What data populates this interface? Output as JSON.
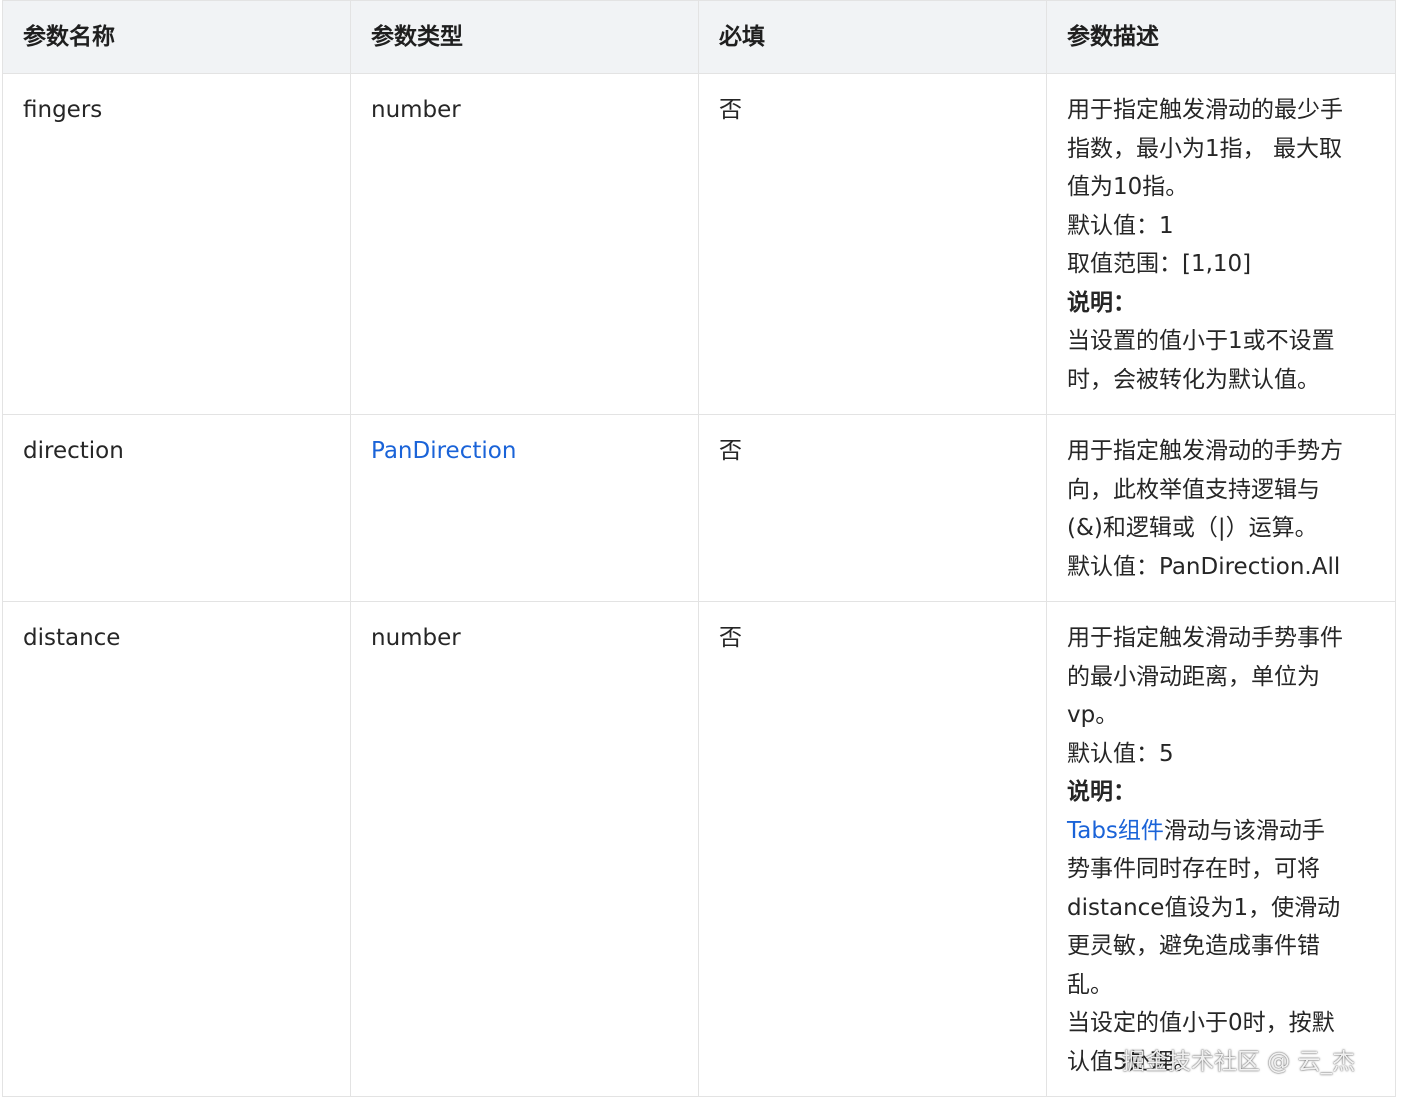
{
  "table": {
    "headers": [
      "参数名称",
      "参数类型",
      "必填",
      "参数描述"
    ],
    "rows": [
      {
        "name": "fingers",
        "type": "number",
        "type_is_link": false,
        "required": "否",
        "description_lines": [
          "用于指定触发滑动的最少手",
          "指数，最小为1指， 最大取",
          "值为10指。",
          "默认值：1",
          "取值范围：[1,10]"
        ],
        "note_title": "说明：",
        "note_lines": [
          "当设置的值小于1或不设置",
          "时，会被转化为默认值。"
        ]
      },
      {
        "name": "direction",
        "type": "PanDirection",
        "type_is_link": true,
        "required": "否",
        "description_lines": [
          "用于指定触发滑动的手势方",
          "向，此枚举值支持逻辑与",
          "(&)和逻辑或（|）运算。",
          "默认值：PanDirection.All"
        ]
      },
      {
        "name": "distance",
        "type": "number",
        "type_is_link": false,
        "required": "否",
        "description_lines": [
          "用于指定触发滑动手势事件",
          "的最小滑动距离，单位为",
          "vp。",
          "默认值：5"
        ],
        "note_title": "说明：",
        "note_link": "Tabs组件",
        "note_lines": [
          "滑动与该滑动手",
          "势事件同时存在时，可将",
          "distance值设为1，使滑动",
          "更灵敏，避免造成事件错",
          "乱。",
          "当设定的值小于0时，按默",
          "认值5处理。"
        ]
      }
    ]
  },
  "watermark": "掘金技术社区 @ 云_杰",
  "colors": {
    "header_bg": "#f1f3f5",
    "border": "#e3e3e3",
    "link": "#1a63d8",
    "text": "#262626"
  }
}
